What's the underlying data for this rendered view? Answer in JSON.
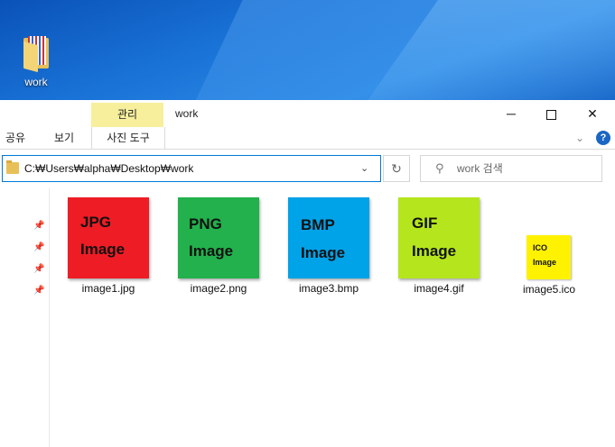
{
  "desktop": {
    "icon_label": "work"
  },
  "window": {
    "title": "work",
    "context_tab": "관리",
    "controls": {
      "minimize": "─",
      "close": "✕"
    }
  },
  "ribbon": {
    "tabs": [
      "공유",
      "보기",
      "사진 도구"
    ],
    "expand": "⌄",
    "help": "?"
  },
  "address": {
    "path": "C:₩Users₩alpha₩Desktop₩work",
    "dropdown": "⌄",
    "refresh": "↻"
  },
  "search": {
    "icon": "⚲",
    "placeholder": "work 검색"
  },
  "quick_access_pins": [
    "📌",
    "📌",
    "📌",
    "📌"
  ],
  "files": [
    {
      "name": "image1.jpg",
      "line1": "JPG",
      "line2": "Image",
      "color": "#ee1c25"
    },
    {
      "name": "image2.png",
      "line1": "PNG",
      "line2": "Image",
      "color": "#22b14c"
    },
    {
      "name": "image3.bmp",
      "line1": "BMP",
      "line2": "Image",
      "color": "#00a2e8"
    },
    {
      "name": "image4.gif",
      "line1": "GIF",
      "line2": "Image",
      "color": "#b5e61d"
    },
    {
      "name": "image5.ico",
      "line1": "ICO",
      "line2": "Image",
      "color": "#fff200"
    }
  ]
}
